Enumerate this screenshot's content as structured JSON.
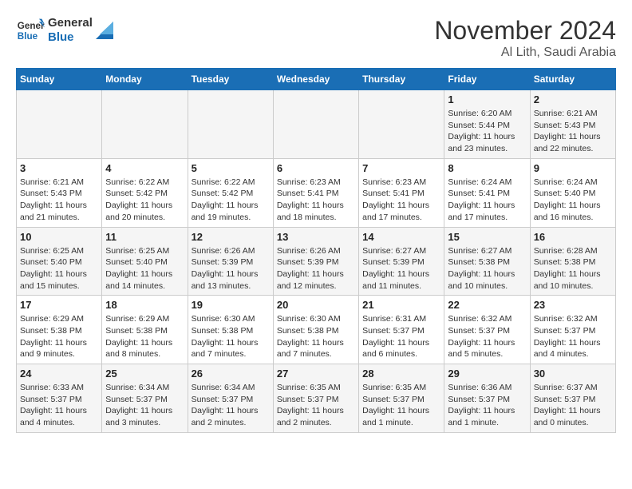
{
  "header": {
    "logo_general": "General",
    "logo_blue": "Blue",
    "month_title": "November 2024",
    "location": "Al Lith, Saudi Arabia"
  },
  "weekdays": [
    "Sunday",
    "Monday",
    "Tuesday",
    "Wednesday",
    "Thursday",
    "Friday",
    "Saturday"
  ],
  "weeks": [
    [
      {
        "day": "",
        "info": ""
      },
      {
        "day": "",
        "info": ""
      },
      {
        "day": "",
        "info": ""
      },
      {
        "day": "",
        "info": ""
      },
      {
        "day": "",
        "info": ""
      },
      {
        "day": "1",
        "info": "Sunrise: 6:20 AM\nSunset: 5:44 PM\nDaylight: 11 hours and 23 minutes."
      },
      {
        "day": "2",
        "info": "Sunrise: 6:21 AM\nSunset: 5:43 PM\nDaylight: 11 hours and 22 minutes."
      }
    ],
    [
      {
        "day": "3",
        "info": "Sunrise: 6:21 AM\nSunset: 5:43 PM\nDaylight: 11 hours and 21 minutes."
      },
      {
        "day": "4",
        "info": "Sunrise: 6:22 AM\nSunset: 5:42 PM\nDaylight: 11 hours and 20 minutes."
      },
      {
        "day": "5",
        "info": "Sunrise: 6:22 AM\nSunset: 5:42 PM\nDaylight: 11 hours and 19 minutes."
      },
      {
        "day": "6",
        "info": "Sunrise: 6:23 AM\nSunset: 5:41 PM\nDaylight: 11 hours and 18 minutes."
      },
      {
        "day": "7",
        "info": "Sunrise: 6:23 AM\nSunset: 5:41 PM\nDaylight: 11 hours and 17 minutes."
      },
      {
        "day": "8",
        "info": "Sunrise: 6:24 AM\nSunset: 5:41 PM\nDaylight: 11 hours and 17 minutes."
      },
      {
        "day": "9",
        "info": "Sunrise: 6:24 AM\nSunset: 5:40 PM\nDaylight: 11 hours and 16 minutes."
      }
    ],
    [
      {
        "day": "10",
        "info": "Sunrise: 6:25 AM\nSunset: 5:40 PM\nDaylight: 11 hours and 15 minutes."
      },
      {
        "day": "11",
        "info": "Sunrise: 6:25 AM\nSunset: 5:40 PM\nDaylight: 11 hours and 14 minutes."
      },
      {
        "day": "12",
        "info": "Sunrise: 6:26 AM\nSunset: 5:39 PM\nDaylight: 11 hours and 13 minutes."
      },
      {
        "day": "13",
        "info": "Sunrise: 6:26 AM\nSunset: 5:39 PM\nDaylight: 11 hours and 12 minutes."
      },
      {
        "day": "14",
        "info": "Sunrise: 6:27 AM\nSunset: 5:39 PM\nDaylight: 11 hours and 11 minutes."
      },
      {
        "day": "15",
        "info": "Sunrise: 6:27 AM\nSunset: 5:38 PM\nDaylight: 11 hours and 10 minutes."
      },
      {
        "day": "16",
        "info": "Sunrise: 6:28 AM\nSunset: 5:38 PM\nDaylight: 11 hours and 10 minutes."
      }
    ],
    [
      {
        "day": "17",
        "info": "Sunrise: 6:29 AM\nSunset: 5:38 PM\nDaylight: 11 hours and 9 minutes."
      },
      {
        "day": "18",
        "info": "Sunrise: 6:29 AM\nSunset: 5:38 PM\nDaylight: 11 hours and 8 minutes."
      },
      {
        "day": "19",
        "info": "Sunrise: 6:30 AM\nSunset: 5:38 PM\nDaylight: 11 hours and 7 minutes."
      },
      {
        "day": "20",
        "info": "Sunrise: 6:30 AM\nSunset: 5:38 PM\nDaylight: 11 hours and 7 minutes."
      },
      {
        "day": "21",
        "info": "Sunrise: 6:31 AM\nSunset: 5:37 PM\nDaylight: 11 hours and 6 minutes."
      },
      {
        "day": "22",
        "info": "Sunrise: 6:32 AM\nSunset: 5:37 PM\nDaylight: 11 hours and 5 minutes."
      },
      {
        "day": "23",
        "info": "Sunrise: 6:32 AM\nSunset: 5:37 PM\nDaylight: 11 hours and 4 minutes."
      }
    ],
    [
      {
        "day": "24",
        "info": "Sunrise: 6:33 AM\nSunset: 5:37 PM\nDaylight: 11 hours and 4 minutes."
      },
      {
        "day": "25",
        "info": "Sunrise: 6:34 AM\nSunset: 5:37 PM\nDaylight: 11 hours and 3 minutes."
      },
      {
        "day": "26",
        "info": "Sunrise: 6:34 AM\nSunset: 5:37 PM\nDaylight: 11 hours and 2 minutes."
      },
      {
        "day": "27",
        "info": "Sunrise: 6:35 AM\nSunset: 5:37 PM\nDaylight: 11 hours and 2 minutes."
      },
      {
        "day": "28",
        "info": "Sunrise: 6:35 AM\nSunset: 5:37 PM\nDaylight: 11 hours and 1 minute."
      },
      {
        "day": "29",
        "info": "Sunrise: 6:36 AM\nSunset: 5:37 PM\nDaylight: 11 hours and 1 minute."
      },
      {
        "day": "30",
        "info": "Sunrise: 6:37 AM\nSunset: 5:37 PM\nDaylight: 11 hours and 0 minutes."
      }
    ]
  ]
}
